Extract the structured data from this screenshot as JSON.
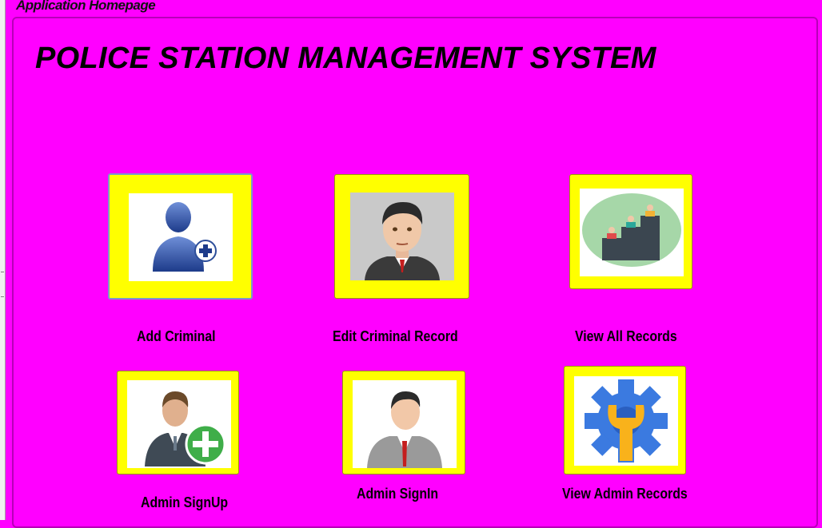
{
  "window": {
    "title": "Application Homepage"
  },
  "heading": "POLICE STATION MANAGEMENT SYSTEM",
  "tiles": [
    {
      "label": "Add Criminal",
      "icon": "add-user-icon"
    },
    {
      "label": "Edit Criminal Record",
      "icon": "officer-avatar-icon"
    },
    {
      "label": "View All Records",
      "icon": "records-chart-icon"
    },
    {
      "label": "Admin SignUp",
      "icon": "admin-add-icon"
    },
    {
      "label": "Admin SignIn",
      "icon": "admin-user-icon"
    },
    {
      "label": "View Admin Records",
      "icon": "settings-wrench-icon"
    }
  ],
  "colors": {
    "background": "#ff00ff",
    "tile": "#ffff00",
    "text": "#000000"
  }
}
